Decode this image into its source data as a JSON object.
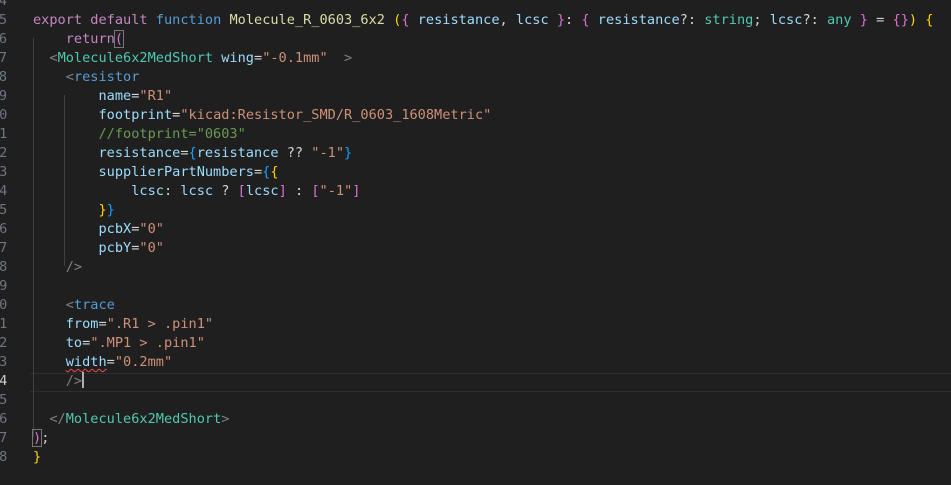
{
  "editor": {
    "language": "tsx",
    "cursor_line": 24,
    "lines": [
      {
        "num": "4",
        "tokens": []
      },
      {
        "num": "5",
        "tokens": [
          {
            "t": "export",
            "c": "ctl"
          },
          {
            "t": " "
          },
          {
            "t": "default",
            "c": "ctl"
          },
          {
            "t": " "
          },
          {
            "t": "function",
            "c": "kw"
          },
          {
            "t": " "
          },
          {
            "t": "Molecule_R_0603_6x2",
            "c": "fn"
          },
          {
            "t": " "
          },
          {
            "t": "(",
            "c": "br1"
          },
          {
            "t": "{",
            "c": "br2"
          },
          {
            "t": " "
          },
          {
            "t": "resistance",
            "c": "var"
          },
          {
            "t": ", "
          },
          {
            "t": "lcsc",
            "c": "var"
          },
          {
            "t": " "
          },
          {
            "t": "}",
            "c": "br2"
          },
          {
            "t": ": "
          },
          {
            "t": "{",
            "c": "br2"
          },
          {
            "t": " "
          },
          {
            "t": "resistance",
            "c": "var"
          },
          {
            "t": "?: "
          },
          {
            "t": "string",
            "c": "type"
          },
          {
            "t": "; "
          },
          {
            "t": "lcsc",
            "c": "var"
          },
          {
            "t": "?: "
          },
          {
            "t": "any",
            "c": "type"
          },
          {
            "t": " "
          },
          {
            "t": "}",
            "c": "br2"
          },
          {
            "t": " = "
          },
          {
            "t": "{",
            "c": "br2"
          },
          {
            "t": "}",
            "c": "br2"
          },
          {
            "t": ")",
            "c": "br1"
          },
          {
            "t": " "
          },
          {
            "t": "{",
            "c": "br1"
          }
        ]
      },
      {
        "num": "6",
        "tokens": [
          {
            "t": "    "
          },
          {
            "t": "return",
            "c": "ctl"
          },
          {
            "t": "(",
            "c": "br2",
            "m": 1
          }
        ]
      },
      {
        "num": "7",
        "tokens": [
          {
            "t": "  "
          },
          {
            "t": "<",
            "c": "tag"
          },
          {
            "t": "Molecule6x2MedShort",
            "c": "type"
          },
          {
            "t": " "
          },
          {
            "t": "wing",
            "c": "var"
          },
          {
            "t": "="
          },
          {
            "t": "\"-0.1mm\"",
            "c": "str"
          },
          {
            "t": "  "
          },
          {
            "t": ">",
            "c": "tag"
          }
        ]
      },
      {
        "num": "8",
        "tokens": [
          {
            "t": "    "
          },
          {
            "t": "<",
            "c": "tag"
          },
          {
            "t": "resistor",
            "c": "kw"
          }
        ]
      },
      {
        "num": "9",
        "tokens": [
          {
            "t": "        "
          },
          {
            "t": "name",
            "c": "var"
          },
          {
            "t": "="
          },
          {
            "t": "\"R1\"",
            "c": "str"
          }
        ]
      },
      {
        "num": "10",
        "tokens": [
          {
            "t": "        "
          },
          {
            "t": "footprint",
            "c": "var"
          },
          {
            "t": "="
          },
          {
            "t": "\"kicad:Resistor_SMD/R_0603_1608Metric\"",
            "c": "str"
          }
        ]
      },
      {
        "num": "11",
        "tokens": [
          {
            "t": "        "
          },
          {
            "t": "//footprint=\"0603\"",
            "c": "com"
          }
        ]
      },
      {
        "num": "12",
        "tokens": [
          {
            "t": "        "
          },
          {
            "t": "resistance",
            "c": "var"
          },
          {
            "t": "="
          },
          {
            "t": "{",
            "c": "br3"
          },
          {
            "t": "resistance",
            "c": "var"
          },
          {
            "t": " ?? "
          },
          {
            "t": "\"-1\"",
            "c": "str"
          },
          {
            "t": "}",
            "c": "br3"
          }
        ]
      },
      {
        "num": "13",
        "tokens": [
          {
            "t": "        "
          },
          {
            "t": "supplierPartNumbers",
            "c": "var"
          },
          {
            "t": "="
          },
          {
            "t": "{",
            "c": "br3"
          },
          {
            "t": "{",
            "c": "br1"
          }
        ]
      },
      {
        "num": "14",
        "tokens": [
          {
            "t": "            "
          },
          {
            "t": "lcsc",
            "c": "var"
          },
          {
            "t": ": "
          },
          {
            "t": "lcsc",
            "c": "var"
          },
          {
            "t": " ? "
          },
          {
            "t": "[",
            "c": "br2"
          },
          {
            "t": "lcsc",
            "c": "var"
          },
          {
            "t": "]",
            "c": "br2"
          },
          {
            "t": " : "
          },
          {
            "t": "[",
            "c": "br2"
          },
          {
            "t": "\"-1\"",
            "c": "str"
          },
          {
            "t": "]",
            "c": "br2"
          }
        ]
      },
      {
        "num": "15",
        "tokens": [
          {
            "t": "        "
          },
          {
            "t": "}",
            "c": "br1"
          },
          {
            "t": "}",
            "c": "br3"
          }
        ]
      },
      {
        "num": "16",
        "tokens": [
          {
            "t": "        "
          },
          {
            "t": "pcbX",
            "c": "var"
          },
          {
            "t": "="
          },
          {
            "t": "\"0\"",
            "c": "str"
          }
        ]
      },
      {
        "num": "17",
        "tokens": [
          {
            "t": "        "
          },
          {
            "t": "pcbY",
            "c": "var"
          },
          {
            "t": "="
          },
          {
            "t": "\"0\"",
            "c": "str"
          }
        ]
      },
      {
        "num": "18",
        "tokens": [
          {
            "t": "    "
          },
          {
            "t": "/>",
            "c": "tag"
          }
        ]
      },
      {
        "num": "19",
        "tokens": []
      },
      {
        "num": "20",
        "tokens": [
          {
            "t": "    "
          },
          {
            "t": "<",
            "c": "tag"
          },
          {
            "t": "trace",
            "c": "kw"
          }
        ]
      },
      {
        "num": "21",
        "tokens": [
          {
            "t": "    "
          },
          {
            "t": "from",
            "c": "var"
          },
          {
            "t": "="
          },
          {
            "t": "\".R1 > .pin1\"",
            "c": "str"
          }
        ]
      },
      {
        "num": "22",
        "tokens": [
          {
            "t": "    "
          },
          {
            "t": "to",
            "c": "var"
          },
          {
            "t": "="
          },
          {
            "t": "\".MP1 > .pin1\"",
            "c": "str"
          }
        ]
      },
      {
        "num": "23",
        "tokens": [
          {
            "t": "    "
          },
          {
            "t": "width",
            "c": "var",
            "sq": 1
          },
          {
            "t": "="
          },
          {
            "t": "\"0.2mm\"",
            "c": "str"
          }
        ]
      },
      {
        "num": "24",
        "tokens": [
          {
            "t": "    "
          },
          {
            "t": "/>",
            "c": "tag"
          }
        ]
      },
      {
        "num": "25",
        "tokens": []
      },
      {
        "num": "26",
        "tokens": [
          {
            "t": "  "
          },
          {
            "t": "</",
            "c": "tag"
          },
          {
            "t": "Molecule6x2MedShort",
            "c": "type"
          },
          {
            "t": ">",
            "c": "tag"
          }
        ]
      },
      {
        "num": "27",
        "tokens": [
          {
            "t": ")",
            "c": "br2",
            "m": 1
          },
          {
            "t": ";"
          }
        ]
      },
      {
        "num": "28",
        "tokens": [
          {
            "t": "}",
            "c": "br1"
          }
        ]
      }
    ]
  }
}
